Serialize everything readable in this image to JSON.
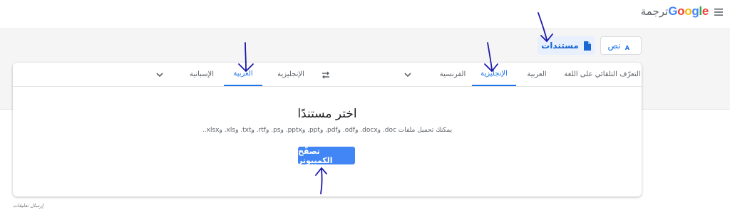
{
  "header": {
    "brand": "Google",
    "product": "ترجمة"
  },
  "modes": {
    "text_label": "نص",
    "documents_label": "مستندات"
  },
  "source_langs": [
    "التعرّف التلقائي على اللغة",
    "العربية",
    "الإنجليزية",
    "الفرنسية"
  ],
  "target_langs": [
    "الإنجليزية",
    "العربية",
    "الإسبانية"
  ],
  "document": {
    "title": "اختر مستندًا",
    "description": "يمكنك تحميل ملفات ‎.doc‎ و‎.docx‎ و‎.odf‎ و‎.pdf‎ و‎.ppt‎ و‎.pptx‎ و‎.ps‎ و‎.rtf‎ و‎.txt‎ و‎.xls‎ و‎.xlsx‎.",
    "browse_label": "تصفّح الكمبيوتر"
  },
  "footer": {
    "feedback": "إرسال تعليقات"
  },
  "colors": {
    "accent": "#1a73e8",
    "button": "#4285f4",
    "annotation": "#1c1aa8"
  }
}
